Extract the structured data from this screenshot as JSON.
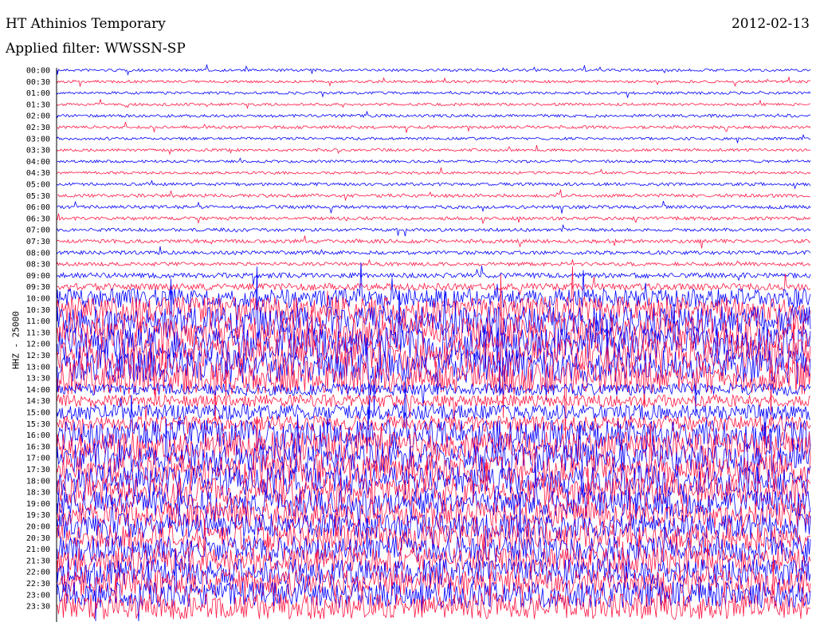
{
  "header": {
    "title": "HT Athinios Temporary",
    "date": "2012-02-13",
    "filter": "Applied filter: WWSSN-SP"
  },
  "station_label": "HHZ - 25000",
  "colors": {
    "trace_a": "#0000ff",
    "trace_b": "#ff1744",
    "background": "#ffffff"
  },
  "chart_data": {
    "type": "line",
    "title": "HT Athinios Temporary",
    "subtitle": "Applied filter: WWSSN-SP",
    "ylabel": "HHZ - 25000",
    "row_labels": [
      "00:00",
      "00:30",
      "01:00",
      "01:30",
      "02:00",
      "02:30",
      "03:00",
      "03:30",
      "04:00",
      "04:30",
      "05:00",
      "05:30",
      "06:00",
      "06:30",
      "07:00",
      "07:30",
      "08:00",
      "08:30",
      "09:00",
      "09:30",
      "10:00",
      "10:30",
      "11:00",
      "11:30",
      "12:00",
      "12:30",
      "13:00",
      "13:30",
      "14:00",
      "14:30",
      "15:00",
      "15:30",
      "16:00",
      "16:30",
      "17:00",
      "17:30",
      "18:00",
      "18:30",
      "19:00",
      "19:30",
      "20:00",
      "20:30",
      "21:00",
      "21:30",
      "22:00",
      "22:30",
      "23:00",
      "23:30"
    ],
    "series": [
      {
        "values": [
          0.03,
          0.03,
          0.03,
          0.03,
          0.04,
          0.04,
          0.03,
          0.03,
          0.03,
          0.03,
          0.04,
          0.05,
          0.05,
          0.05,
          0.05,
          0.06,
          0.06,
          0.06,
          0.1,
          0.15,
          0.5,
          0.7,
          0.8,
          0.85,
          0.9,
          0.9,
          0.9,
          0.9,
          0.3,
          0.3,
          0.4,
          0.4,
          0.8,
          0.8,
          0.8,
          0.8,
          0.8,
          0.8,
          0.7,
          0.7,
          0.7,
          0.7,
          0.7,
          0.7,
          0.7,
          0.7,
          0.7,
          0.7
        ]
      }
    ]
  }
}
